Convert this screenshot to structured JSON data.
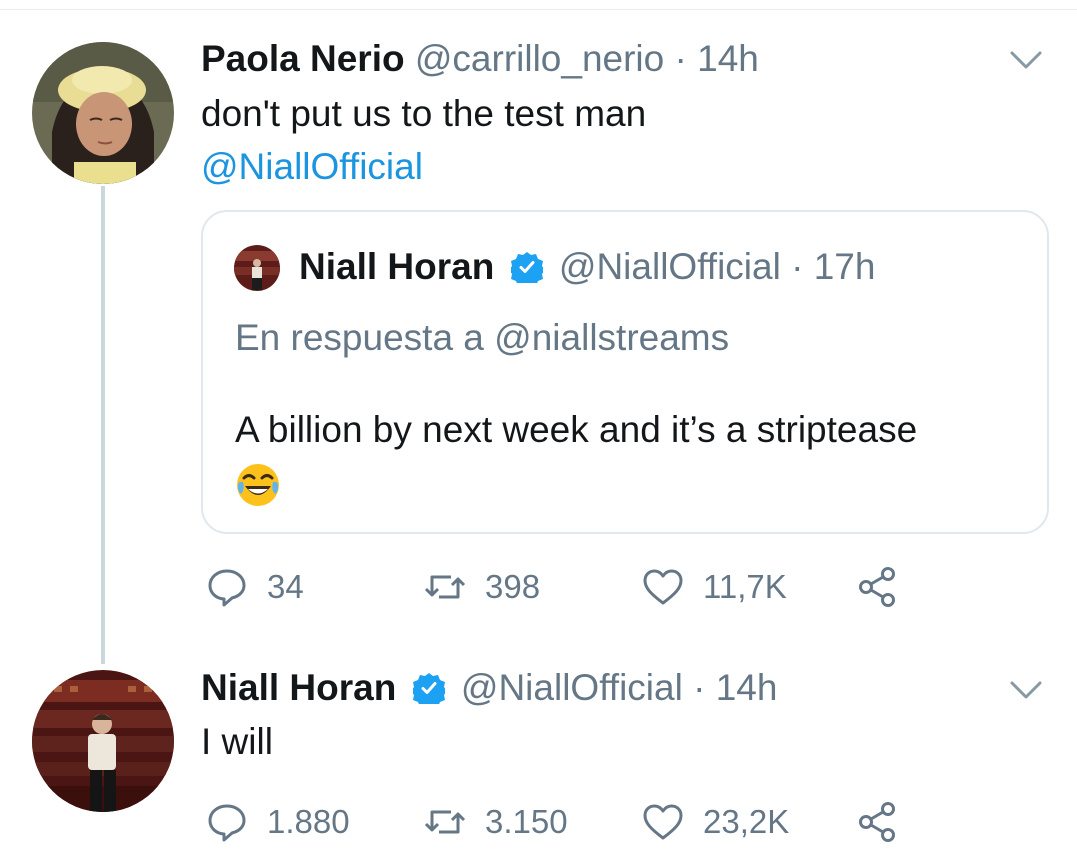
{
  "tweets": [
    {
      "name": "Paola Nerio",
      "handle": "@carrillo_nerio",
      "time": "· 14h",
      "text": "don't put us to the test man",
      "mention": "@NiallOfficial",
      "actions": {
        "replies": "34",
        "retweets": "398",
        "likes": "11,7K"
      }
    },
    {
      "name": "Niall Horan",
      "handle": "@NiallOfficial",
      "time": "· 14h",
      "text": "I will",
      "actions": {
        "replies": "1.880",
        "retweets": "3.150",
        "likes": "23,2K"
      }
    }
  ],
  "quoted": {
    "name": "Niall Horan",
    "handle": "@NiallOfficial",
    "time": "· 17h",
    "reply_to": "En respuesta a @niallstreams",
    "text": "A billion by next week and it’s a striptease"
  },
  "colors": {
    "link": "#1b95e0",
    "muted": "#657786",
    "verified": "#1da1f2",
    "border": "#e1e8ed"
  },
  "icons": [
    "chevron-down-icon",
    "verified-icon",
    "reply-icon",
    "retweet-icon",
    "like-icon",
    "share-icon",
    "laughing-tears-emoji"
  ]
}
